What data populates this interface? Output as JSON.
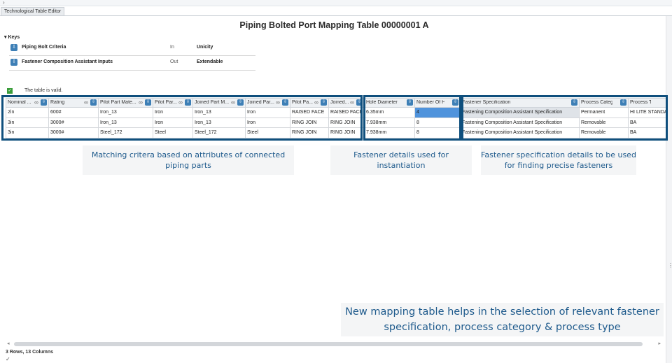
{
  "window": {
    "tab_label": "Technological Table Editor"
  },
  "title": "Piping Bolted Port Mapping Table 00000001 A",
  "keys": {
    "heading": "Keys",
    "rows": [
      {
        "name": "Piping Bolt Criteria",
        "direction": "In",
        "value": "Unicity"
      },
      {
        "name": "Fastener Composition Assistant Inputs",
        "direction": "Out",
        "value": "Extendable"
      }
    ]
  },
  "validation": {
    "text": "The table is valid."
  },
  "table": {
    "columns": [
      "Nominal ...",
      "Rating",
      "Pilot Part Mate...",
      "Pilot Par...",
      "Joined Part M...",
      "Joined Par...",
      "Pilot Pa...",
      "Joined...",
      "Hole Diameter",
      "Number Of Ho...",
      "Fastener Specification",
      "Process Category",
      "Process Type"
    ],
    "rows": [
      [
        "2in",
        "600#",
        "Iron_13",
        "Iron",
        "Iron_13",
        "Iron",
        "RAISED FACE",
        "RAISED FACE",
        "6.35mm",
        "4",
        "Fastening Composition Assistant Specification",
        "Permanent",
        "HI LITE STANDARD"
      ],
      [
        "3in",
        "3000#",
        "Iron_13",
        "Iron",
        "Iron_13",
        "Iron",
        "RING JOIN",
        "RING JOIN",
        "7.938mm",
        "8",
        "Fastening Composition Assistant Specification",
        "Removable",
        "BA"
      ],
      [
        "3in",
        "3000#",
        "Steel_172",
        "Steel",
        "Steel_172",
        "Steel",
        "RING JOIN",
        "RING JOIN",
        "7.938mm",
        "8",
        "Fastening Composition Assistant Specification",
        "Removable",
        "BA"
      ]
    ]
  },
  "callouts": {
    "matching": "Matching critera based on attributes of connected piping  parts",
    "fastener_details": "Fastener details used for instantiation",
    "spec_details": "Fastener specification details to be used for finding precise fasteners",
    "summary": "New mapping table helps in the selection of relevant fastener specification, process category & process type"
  },
  "status": {
    "summary": "3 Rows, 13 Columns"
  },
  "icons": [
    "collapse-arrow-icon",
    "key-icon",
    "valid-check-icon",
    "link-icon",
    "sort-icon",
    "scroll-left-icon",
    "scroll-right-icon",
    "resize-grip-icon"
  ],
  "colors": {
    "frame": "#0f4f7d",
    "callout_text": "#1e5a8c",
    "selected_cell": "#4f93dc",
    "accent_icon": "#3d7fb6",
    "valid": "#3a9d3a"
  }
}
